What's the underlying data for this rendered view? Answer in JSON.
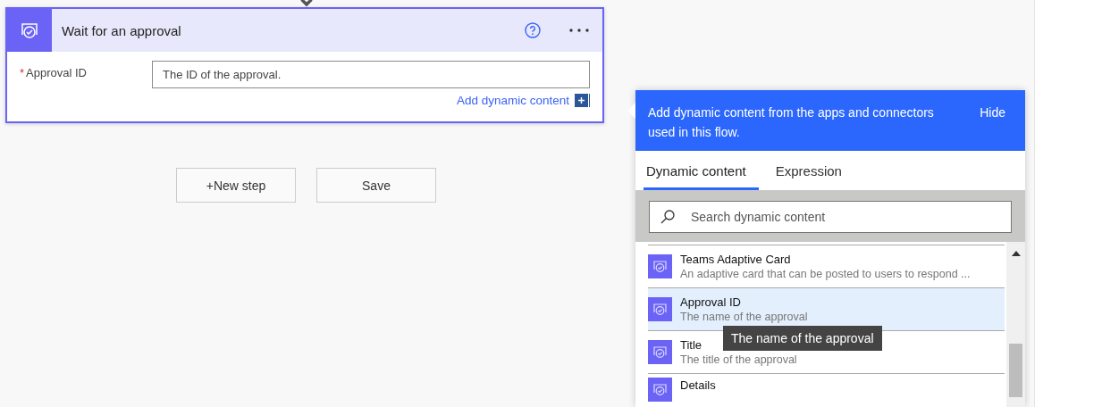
{
  "card": {
    "title": "Wait for an approval",
    "field": {
      "label": "Approval ID",
      "required_mark": "*",
      "placeholder": "The ID of the approval."
    },
    "add_dynamic": "Add dynamic content"
  },
  "buttons": [
    {
      "label": "New step",
      "plus": "+"
    },
    {
      "label": "Save"
    }
  ],
  "panel": {
    "banner": "Add dynamic content from the apps and connectors used in this flow.",
    "hide": "Hide",
    "tabs": [
      {
        "label": "Dynamic content",
        "selected": true
      },
      {
        "label": "Expression",
        "selected": false
      }
    ],
    "search": {
      "placeholder": "Search dynamic content"
    },
    "items": [
      {
        "title": "Teams Adaptive Card",
        "description": "An adaptive card that can be posted to users to respond ...",
        "selected": false
      },
      {
        "title": "Approval ID",
        "description": "The name of the approval",
        "selected": true
      },
      {
        "title": "Title",
        "description": "The title of the approval",
        "selected": false
      },
      {
        "title": "Details",
        "selected": false
      }
    ],
    "tooltip": "The name of the approval"
  }
}
